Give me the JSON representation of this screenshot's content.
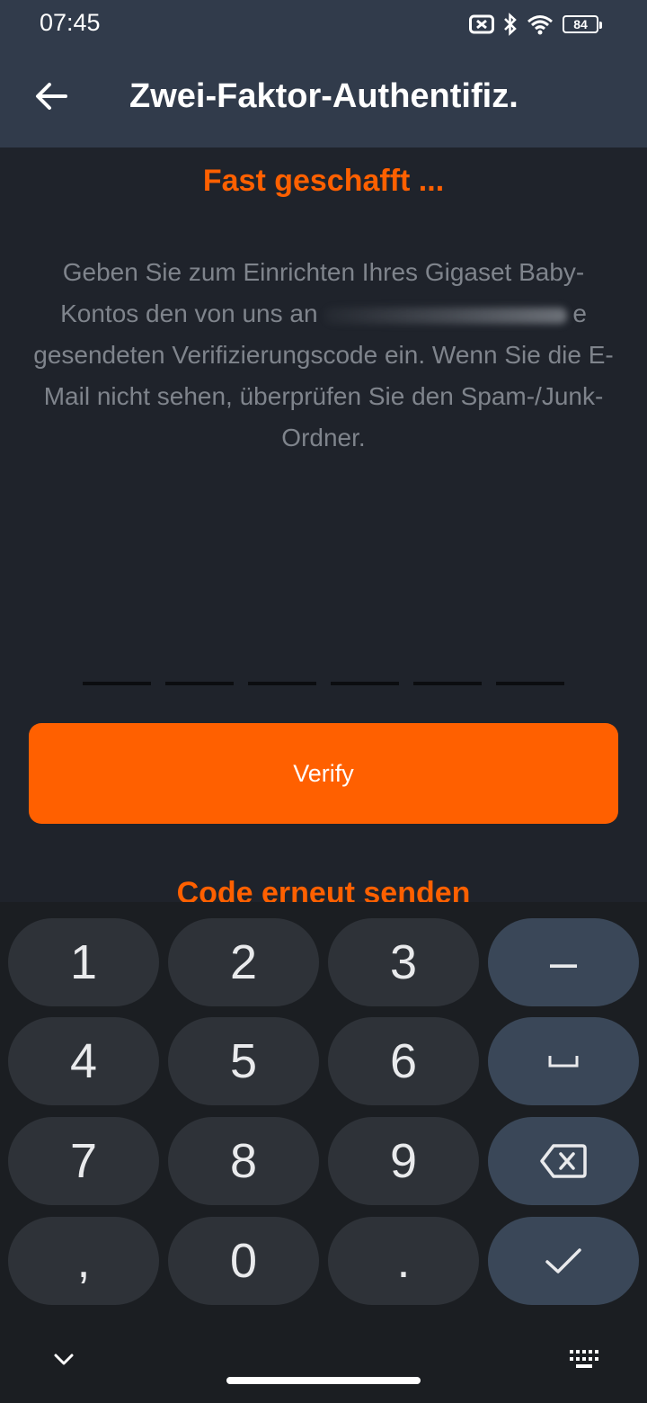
{
  "status_bar": {
    "time": "07:45",
    "battery": "84",
    "icons": [
      "no-sim-icon",
      "bluetooth-icon",
      "wifi-icon",
      "battery-icon"
    ]
  },
  "app_bar": {
    "title": "Zwei-Faktor-Authentifiz.",
    "back_icon": "arrow-left-icon"
  },
  "content": {
    "headline": "Fast geschafft ...",
    "description_before": "Geben Sie zum Einrichten Ihres Gigaset Baby-Kontos den von uns an",
    "description_after": "e gesendeten Verifizierungscode ein. Wenn Sie die E-Mail nicht sehen, überprüfen Sie den Spam-/Junk-Ordner.",
    "code_slots": [
      "",
      "",
      "",
      "",
      "",
      ""
    ],
    "verify_label": "Verify",
    "resend_label": "Code erneut senden"
  },
  "keyboard": {
    "keys": [
      {
        "label": "1"
      },
      {
        "label": "2"
      },
      {
        "label": "3"
      },
      {
        "label": "–"
      },
      {
        "label": "4"
      },
      {
        "label": "5"
      },
      {
        "label": "6"
      },
      {
        "label": "space",
        "icon": "space-icon"
      },
      {
        "label": "7"
      },
      {
        "label": "8"
      },
      {
        "label": "9"
      },
      {
        "label": "backspace",
        "icon": "backspace-icon"
      },
      {
        "label": ","
      },
      {
        "label": "0"
      },
      {
        "label": "."
      },
      {
        "label": "done",
        "icon": "checkmark-icon"
      }
    ]
  },
  "colors": {
    "accent": "#ff6000",
    "app_bar": "#313b4b",
    "background": "#1f232b",
    "key": "#2e3238",
    "function_key": "#3a4758"
  }
}
